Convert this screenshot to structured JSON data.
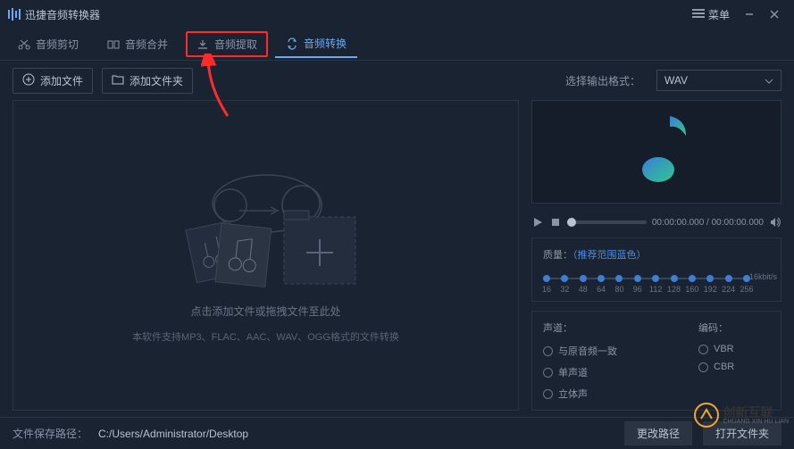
{
  "titlebar": {
    "app_name": "迅捷音频转换器",
    "menu_label": "菜单"
  },
  "tabs": {
    "cut": "音频剪切",
    "merge": "音频合并",
    "extract": "音频提取",
    "convert": "音频转换"
  },
  "toolbar": {
    "add_file": "添加文件",
    "add_folder": "添加文件夹",
    "format_label": "选择输出格式：",
    "format_value": "WAV"
  },
  "dropzone": {
    "line1": "点击添加文件或拖拽文件至此处",
    "line2": "本软件支持MP3、FLAC、AAC、WAV、OGG格式的文件转换"
  },
  "player": {
    "time_current": "00:00:00.000",
    "time_total": "00:00:00.000"
  },
  "quality": {
    "label_prefix": "质量：",
    "label_range": "（推荐范围蓝色）",
    "marks": [
      "16",
      "32",
      "48",
      "64",
      "80",
      "96",
      "112",
      "128",
      "160",
      "192",
      "224",
      "256"
    ],
    "unit": "16kbit/s"
  },
  "channel": {
    "title": "声道：",
    "same": "与原音频一致",
    "mono": "单声道",
    "stereo": "立体声"
  },
  "encode": {
    "title": "编码：",
    "vbr": "VBR",
    "cbr": "CBR"
  },
  "bottombar": {
    "path_label": "文件保存路径：",
    "path_value": "C:/Users/Administrator/Desktop",
    "change_path": "更改路径",
    "open_folder": "打开文件夹"
  },
  "watermark": {
    "cn": "创新互联",
    "en": "CHUANG XIN HU LIAN"
  },
  "colors": {
    "accent": "#6aa9f2",
    "slider_dot": "#3d7dd6",
    "highlight_red": "#ff2a2a"
  }
}
